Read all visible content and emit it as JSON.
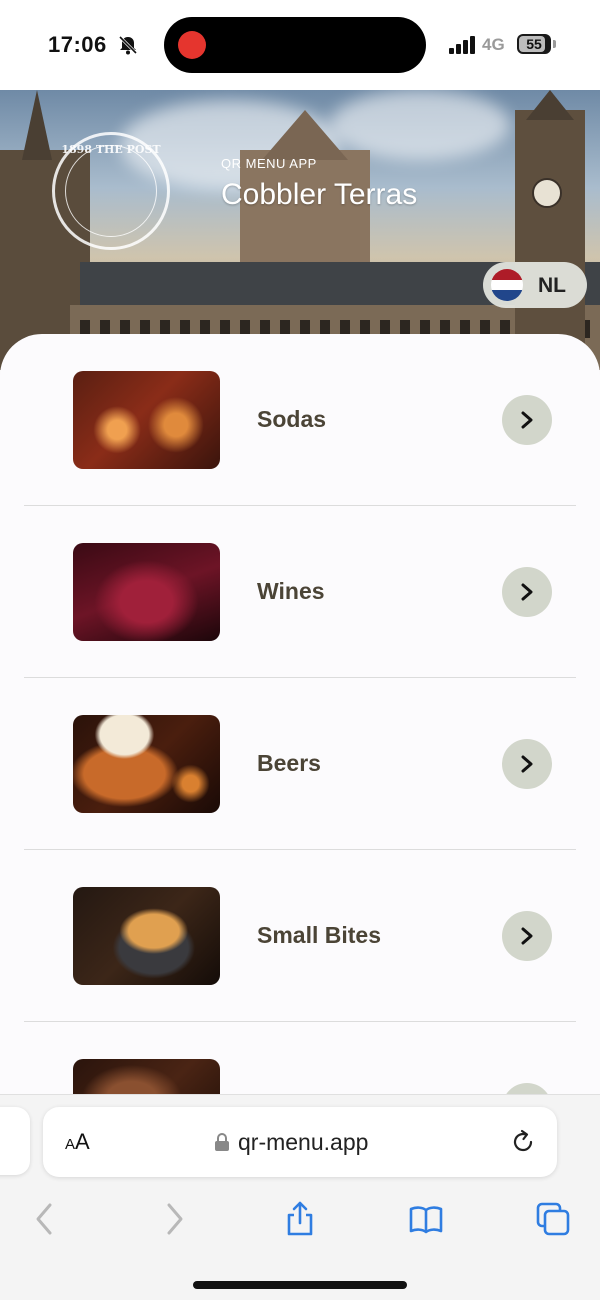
{
  "status_bar": {
    "time": "17:06",
    "network": "4G",
    "battery": "55",
    "icons": [
      "bell-slash-icon",
      "signal-bars-icon",
      "battery-icon"
    ]
  },
  "hero": {
    "seal_text": "1898 THE POST",
    "subtitle": "QR MENU APP",
    "title": "Cobbler Terras",
    "language_button": "NL",
    "flag_colors": [
      "#ae1c28",
      "#ffffff",
      "#21468b"
    ]
  },
  "menu": {
    "items": [
      {
        "label": "Sodas",
        "icon": "chevron-right-icon"
      },
      {
        "label": "Wines",
        "icon": "chevron-right-icon"
      },
      {
        "label": "Beers",
        "icon": "chevron-right-icon"
      },
      {
        "label": "Small Bites",
        "icon": "chevron-right-icon"
      },
      {
        "label": "",
        "icon": "chevron-right-icon"
      }
    ]
  },
  "browser": {
    "text_size_label": "AA",
    "url": "qr-menu.app",
    "toolbar": [
      "back-icon",
      "forward-icon",
      "share-icon",
      "bookmarks-icon",
      "tabs-icon"
    ]
  },
  "colors": {
    "accent_text": "#4b4436",
    "arrow_button": "#d2d6cb",
    "ios_blue": "#2f7de1"
  }
}
